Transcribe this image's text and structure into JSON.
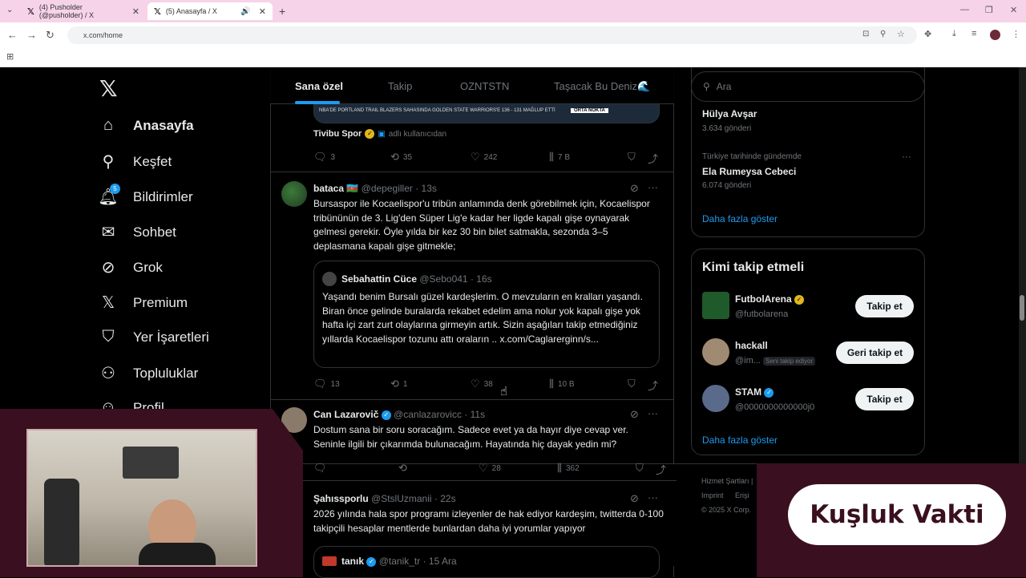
{
  "browser": {
    "tabs": [
      {
        "title": "(4) Pusholder (@pusholder) / X",
        "active": false
      },
      {
        "title": "(5) Anasayfa / X",
        "active": true
      }
    ],
    "url": "x.com/home"
  },
  "nav": {
    "items": [
      {
        "label": "Anasayfa",
        "icon": "home-icon"
      },
      {
        "label": "Keşfet",
        "icon": "search-icon"
      },
      {
        "label": "Bildirimler",
        "icon": "bell-icon"
      },
      {
        "label": "Sohbet",
        "icon": "mail-icon"
      },
      {
        "label": "Grok",
        "icon": "grok-icon"
      },
      {
        "label": "Premium",
        "icon": "x-logo-icon"
      },
      {
        "label": "Yer İşaretleri",
        "icon": "bookmark-icon"
      },
      {
        "label": "Topluluklar",
        "icon": "communities-icon"
      },
      {
        "label": "Profil",
        "icon": "profile-icon"
      }
    ],
    "notif_count": "5"
  },
  "feed": {
    "tabs": [
      "Sana özel",
      "Takip",
      "OZNTSTN",
      "Taşacak Bu Deniz🌊"
    ],
    "media_caption": "NBA'DE PORTLAND TRAIL BLAZERS SAHASINDA GOLDEN STATE WARRIORS'E 136 - 131 MAĞLUP ETTİ",
    "media_tag": "ORTA NOKTA",
    "post0": {
      "source_name": "Tivibu Spor",
      "source_suffix": "adlı kullanıcıdan",
      "replies": "3",
      "reposts": "35",
      "likes": "242",
      "views": "7 B"
    },
    "post1": {
      "name": "bataca 🇦🇿",
      "handle": "@depegiller",
      "time": "· 13s",
      "text": "Bursaspor ile Kocaelispor'u tribün anlamında denk görebilmek için, Kocaelispor tribününün de 3. Lig'den Süper Lig'e kadar her ligde kapalı gişe oynayarak gelmesi gerekir. Öyle yılda bir kez 30 bin bilet satmakla, sezonda 3–5 deplasmana kapalı gişe gitmekle;",
      "quote": {
        "name": "Sebahattin Cüce",
        "handle": "@Sebo041",
        "time": "· 16s",
        "text": "Yaşandı benim Bursalı güzel kardeşlerim. O mevzuların en kralları yaşandı. Biran önce gelinde buralarda rekabet edelim ama nolur yok kapalı gişe yok hafta içi zart zurt olaylarına girmeyin artık. Sizin aşağıları takip etmediğiniz yıllarda Kocaelispor tozunu attı oraların .. x.com/Caglarerginn/s..."
      },
      "replies": "13",
      "reposts": "1",
      "likes": "38",
      "views": "10 B"
    },
    "post2": {
      "name": "Can Lazarovič",
      "handle": "@canlazarovicc",
      "time": "· 11s",
      "text": "Dostum sana bir soru soracağım. Sadece evet ya da hayır diye cevap ver. Seninle ilgili bir çıkarımda bulunacağım. Hayatında hiç dayak yedin mi?",
      "likes": "28",
      "views": "362"
    },
    "post3": {
      "name": "Şahıssporlu",
      "handle": "@StslUzmanii",
      "time": "· 22s",
      "text": "2026 yılında hala spor programı izleyenler de hak ediyor kardeşim, twitterda 0-100 takipçili hesaplar mentlerde bunlardan daha iyi yorumlar yapıyor"
    },
    "post4": {
      "name": "tanık",
      "handle": "@tanik_tr",
      "time": "· 15 Ara"
    }
  },
  "right": {
    "search_placeholder": "Ara",
    "trends": [
      {
        "title": "Hülya Avşar",
        "count": "3.634 gönderi"
      },
      {
        "context": "Türkiye tarihinde gündemde",
        "title": "Ela Rumeysa Cebeci",
        "count": "6.074 gönderi"
      }
    ],
    "trends_more": "Daha fazla göster",
    "who_to_follow_title": "Kimi takip etmeli",
    "suggestions": [
      {
        "name": "FutbolArena",
        "handle": "@futbolarena",
        "button": "Takip et"
      },
      {
        "name": "hackall",
        "handle": "@im...",
        "follows_you": "Seni takip ediyor",
        "button": "Geri takip et"
      },
      {
        "name": "STAM",
        "handle": "@0000000000000j0",
        "button": "Takip et"
      }
    ],
    "wtf_more": "Daha fazla göster",
    "footer": [
      "Hizmet Şartları",
      "|",
      "Imprint",
      "Erişi",
      "© 2025 X Corp."
    ]
  },
  "overlay": {
    "brand_text": "Kuşluk Vakti"
  },
  "colors": {
    "accent": "#1d9bf0",
    "brand": "#3a0f1f",
    "tabbar": "#f6d3e8"
  }
}
